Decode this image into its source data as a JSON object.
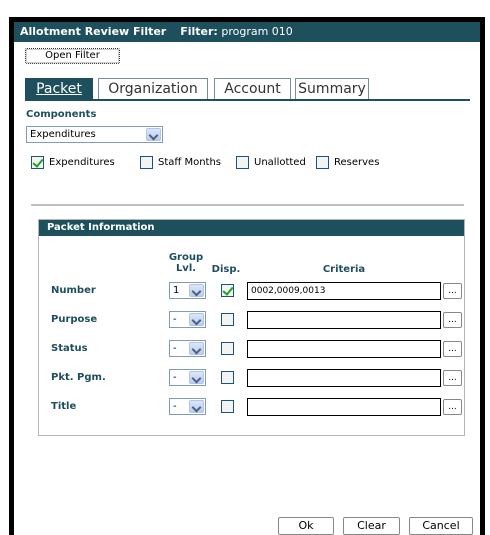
{
  "window": {
    "title": "Allotment Review Filter",
    "filter_label": "Filter:",
    "filter_value": "program 010"
  },
  "open_filter_button": "Open Filter",
  "tabs": [
    {
      "label": "Packet",
      "active": true
    },
    {
      "label": "Organization",
      "active": false
    },
    {
      "label": "Account",
      "active": false
    },
    {
      "label": "Summary",
      "active": false
    }
  ],
  "components": {
    "label": "Components",
    "selected": "Expenditures",
    "checkboxes": [
      {
        "label": "Expenditures",
        "checked": true
      },
      {
        "label": "Staff Months",
        "checked": false
      },
      {
        "label": "Unallotted",
        "checked": false
      },
      {
        "label": "Reserves",
        "checked": false
      }
    ]
  },
  "packet_info": {
    "title": "Packet Information",
    "col_group": "Group",
    "col_lvl": "Lvl.",
    "col_disp": "Disp.",
    "col_criteria": "Criteria",
    "rows": [
      {
        "label": "Number",
        "level": "1",
        "disp": true,
        "criteria": "0002,0009,0013"
      },
      {
        "label": "Purpose",
        "level": "-",
        "disp": false,
        "criteria": ""
      },
      {
        "label": "Status",
        "level": "-",
        "disp": false,
        "criteria": ""
      },
      {
        "label": "Pkt. Pgm.",
        "level": "-",
        "disp": false,
        "criteria": ""
      },
      {
        "label": "Title",
        "level": "-",
        "disp": false,
        "criteria": ""
      }
    ],
    "ellipsis": "..."
  },
  "buttons": {
    "ok": "Ok",
    "clear": "Clear",
    "cancel": "Cancel"
  },
  "colors": {
    "header": "#1e4f5c",
    "check": "#21a121"
  }
}
